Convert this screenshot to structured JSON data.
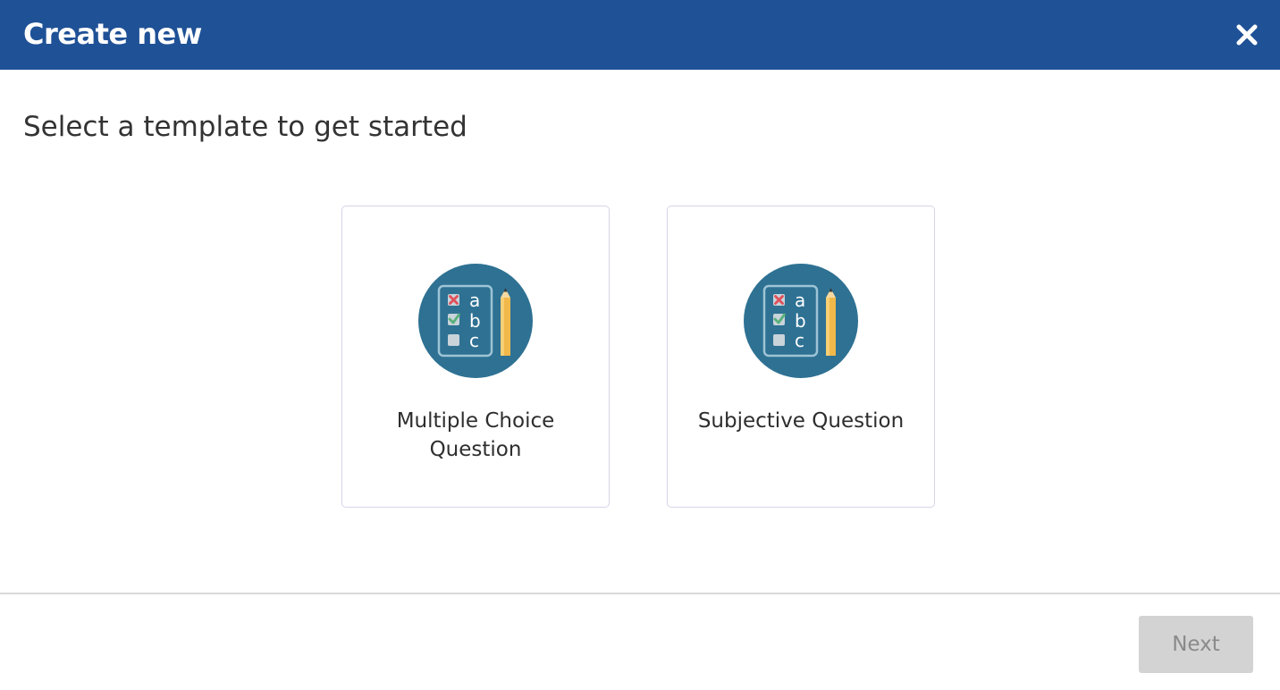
{
  "header": {
    "title": "Create new",
    "close_icon": "close-icon",
    "background_color": "#1f5196"
  },
  "main": {
    "subtitle": "Select a template to get started",
    "templates": [
      {
        "label": "Multiple Choice Question",
        "icon": "multiple-choice-icon",
        "icon_letters": [
          "a",
          "b",
          "c"
        ]
      },
      {
        "label": "Subjective Question",
        "icon": "multiple-choice-icon",
        "icon_letters": [
          "a",
          "b",
          "c"
        ]
      }
    ]
  },
  "footer": {
    "next_label": "Next",
    "next_enabled": false
  },
  "colors": {
    "icon_circle": "#2e7193",
    "pencil": "#f1b84a",
    "cross": "#e0505a",
    "check": "#58b07a"
  }
}
